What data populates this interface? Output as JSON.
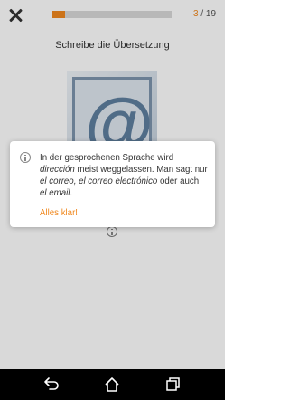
{
  "header": {
    "close_icon": "close-icon",
    "progress": {
      "value": 3,
      "total": 19
    },
    "counter_current": "3",
    "counter_rest": " / 19"
  },
  "exercise": {
    "prompt": "Schreibe die Übersetzung",
    "image_icon": "at-sign-icon"
  },
  "dialog": {
    "icon": "info-icon",
    "parts": {
      "p1": "In der gesprochenen Sprache wird ",
      "e1": "dirección",
      "p2": " meist weggelassen. Man sagt nur ",
      "e2": "el correo, el correo electrónico",
      "p3": " oder auch ",
      "e3": "el email",
      "p4": "."
    },
    "ok_label": "Alles klar!"
  },
  "colors": {
    "accent": "#f0881e",
    "text": "#333333"
  },
  "navbar": {
    "icons": [
      "back-icon",
      "home-icon",
      "recent-apps-icon"
    ]
  }
}
